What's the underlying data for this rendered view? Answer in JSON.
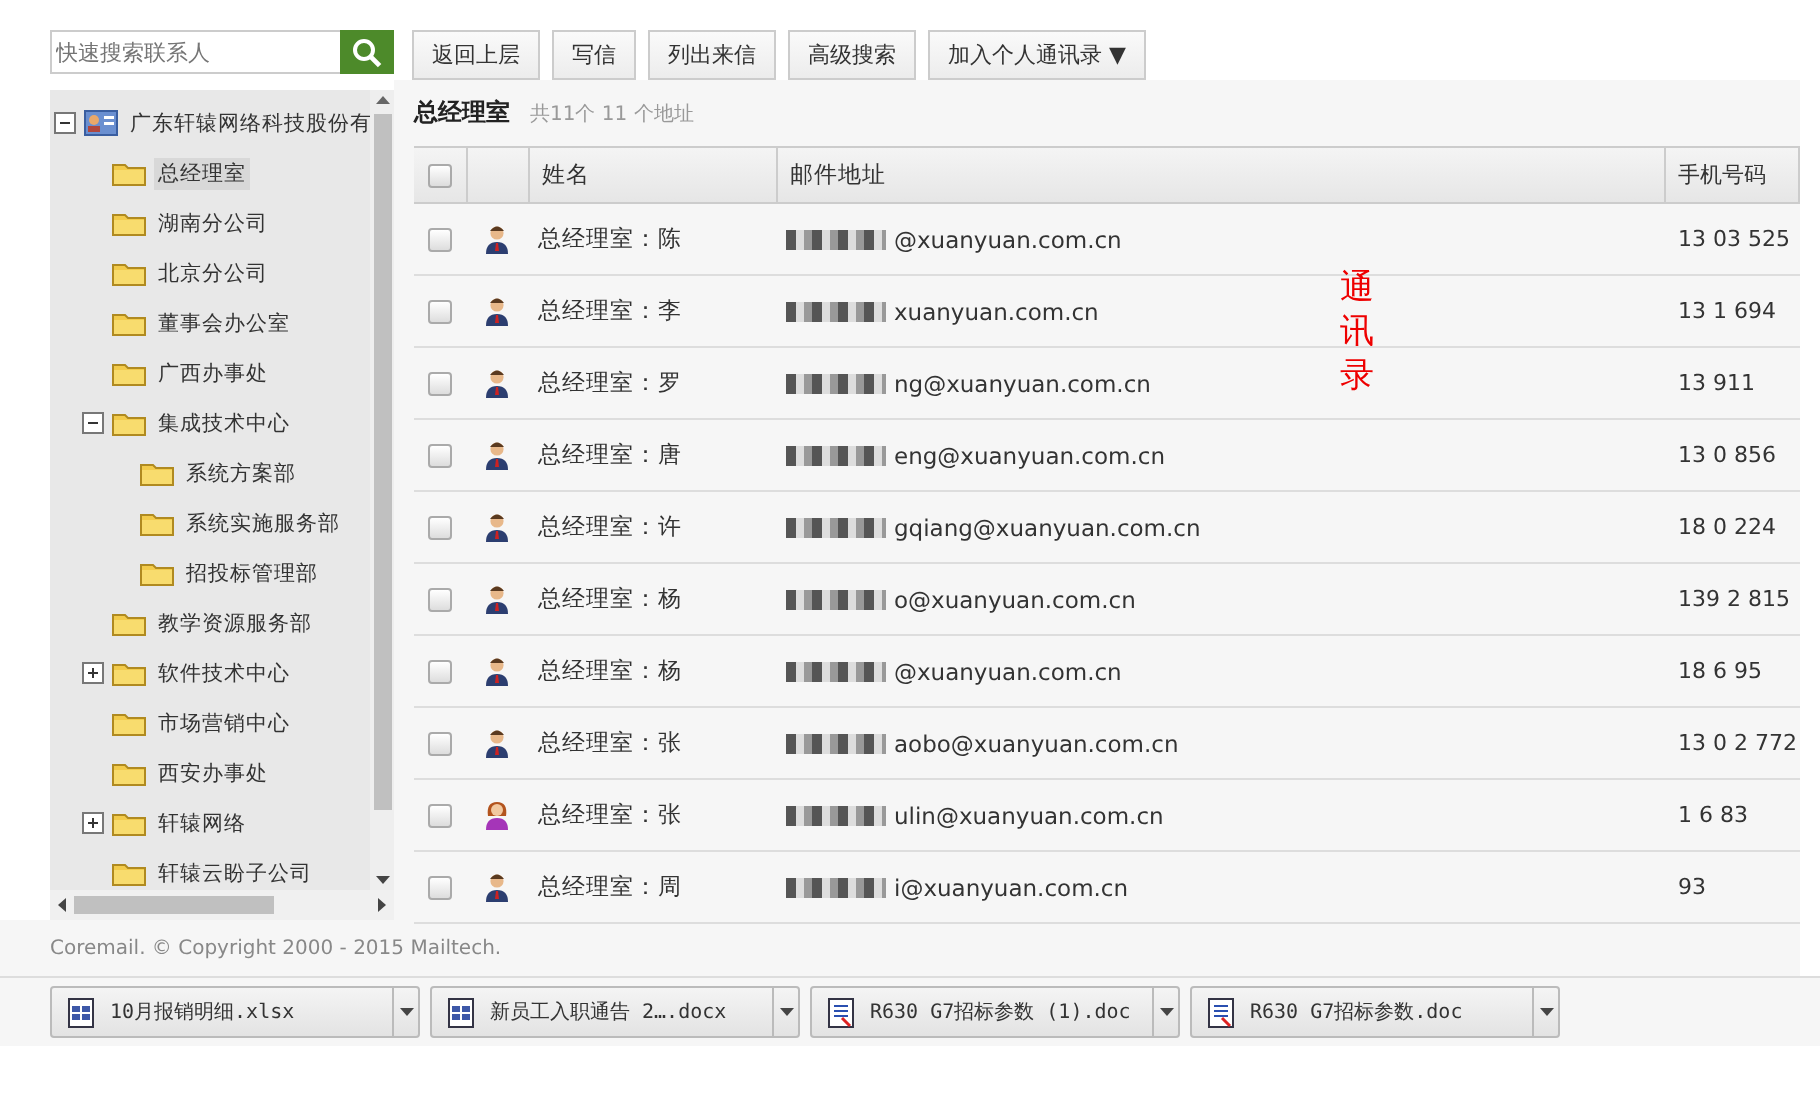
{
  "search": {
    "placeholder": "快速搜索联系人"
  },
  "toolbar": [
    "返回上层",
    "写信",
    "列出来信",
    "高级搜索"
  ],
  "toolbar_menu": {
    "label": "加入个人通讯录",
    "arrow": "▼"
  },
  "tree": [
    {
      "label": "广东轩辕网络科技股份有",
      "kind": "org",
      "expanded": true,
      "selected": false,
      "children": [
        {
          "label": "总经理室",
          "selected": true
        },
        {
          "label": "湖南分公司",
          "selected": false
        },
        {
          "label": "北京分公司",
          "selected": false
        },
        {
          "label": "董事会办公室",
          "selected": false
        },
        {
          "label": "广西办事处",
          "selected": false
        },
        {
          "label": "集成技术中心",
          "selected": false,
          "expanded": true,
          "children": [
            {
              "label": "系统方案部",
              "selected": false
            },
            {
              "label": "系统实施服务部",
              "selected": false
            },
            {
              "label": "招投标管理部",
              "selected": false
            }
          ]
        },
        {
          "label": "教学资源服务部",
          "selected": false
        },
        {
          "label": "软件技术中心",
          "selected": false,
          "expanded": false
        },
        {
          "label": "市场营销中心",
          "selected": false
        },
        {
          "label": "西安办事处",
          "selected": false
        },
        {
          "label": "轩辕网络",
          "selected": false,
          "expanded": false
        },
        {
          "label": "轩辕云盼子公司",
          "selected": false
        }
      ]
    }
  ],
  "folder": {
    "title": "总经理室",
    "count": "共11个 11 个地址"
  },
  "table": {
    "all_checked": false,
    "columns": [
      "姓名",
      "邮件地址",
      "手机号码"
    ],
    "rows": [
      {
        "checked": false,
        "kind": "male",
        "name": "总经理室：陈",
        "email": "@xuanyuan.com.cn",
        "phone": "13 03 525"
      },
      {
        "checked": false,
        "kind": "male",
        "name": "总经理室：李",
        "email": "xuanyuan.com.cn",
        "phone": "13 1 694"
      },
      {
        "checked": false,
        "kind": "male",
        "name": "总经理室：罗",
        "email": "ng@xuanyuan.com.cn",
        "phone": "13 911"
      },
      {
        "checked": false,
        "kind": "male",
        "name": "总经理室：唐",
        "email": "eng@xuanyuan.com.cn",
        "phone": "13 0 856"
      },
      {
        "checked": false,
        "kind": "male",
        "name": "总经理室：许",
        "email": "gqiang@xuanyuan.com.cn",
        "phone": "18 0 224"
      },
      {
        "checked": false,
        "kind": "male",
        "name": "总经理室：杨",
        "email": "o@xuanyuan.com.cn",
        "phone": "139 2 815"
      },
      {
        "checked": false,
        "kind": "male",
        "name": "总经理室：杨",
        "email": "@xuanyuan.com.cn",
        "phone": "18 6 95"
      },
      {
        "checked": false,
        "kind": "male",
        "name": "总经理室：张",
        "email": "aobo@xuanyuan.com.cn",
        "phone": "13 0 2 772"
      },
      {
        "checked": false,
        "kind": "female",
        "name": "总经理室：张",
        "email": "ulin@xuanyuan.com.cn",
        "phone": "1 6 83"
      },
      {
        "checked": false,
        "kind": "male",
        "name": "总经理室：周",
        "email": "i@xuanyuan.com.cn",
        "phone": "93"
      }
    ]
  },
  "annotation": "通讯录",
  "copyright": "Coremail. © Copyright 2000 - 2015 Mailtech.",
  "downloads": [
    {
      "name": "10月报销明细.xlsx",
      "kind": "sheet"
    },
    {
      "name": "新员工入职通告 2….docx",
      "kind": "sheet"
    },
    {
      "name": "R630 G7招标参数 (1).doc",
      "kind": "doc"
    },
    {
      "name": "R630 G7招标参数.doc",
      "kind": "doc"
    }
  ]
}
